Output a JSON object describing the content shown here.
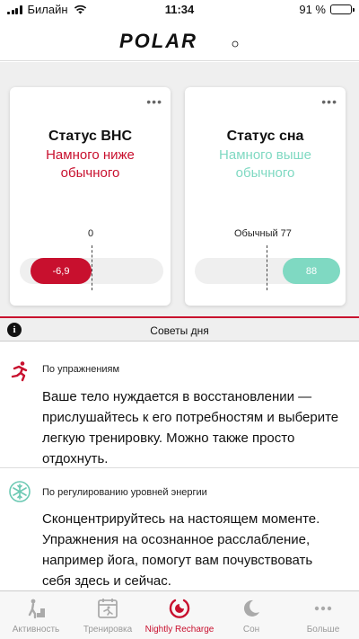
{
  "status_bar": {
    "carrier": "Билайн",
    "time": "11:34",
    "battery_text": "91 %",
    "battery_level": 0.91
  },
  "header": {
    "logo_text": "POLAR"
  },
  "cards": [
    {
      "title": "Статус ВНС",
      "subtitle": "Намного ниже обычного",
      "subtitle_color": "#c8102e",
      "marker_label": "0",
      "value": "-6,9",
      "value_color": "#c8102e"
    },
    {
      "title": "Статус сна",
      "subtitle": "Намного выше обычного",
      "subtitle_color": "#7fd9c2",
      "marker_label": "Обычный 77",
      "value": "88",
      "value_color": "#7fd9c2"
    }
  ],
  "tips_header": {
    "label": "Советы дня"
  },
  "tips": [
    {
      "icon": "running-icon",
      "category": "По упражнениям",
      "text": "Ваше тело нуждается в восстановлении — прислушайтесь к его потребностям и выберите легкую тренировку. Можно также просто отдохнуть."
    },
    {
      "icon": "snowflake-icon",
      "category": "По регулированию уровней энергии",
      "text": "Сконцентрируйтесь на настоящем моменте. Упражнения на осознанное расслабление, например йога, помогут вам почувствовать себя здесь и сейчас."
    }
  ],
  "nav": {
    "items": [
      {
        "label": "Активность",
        "icon": "activity-icon",
        "active": false
      },
      {
        "label": "Тренировка",
        "icon": "training-icon",
        "active": false
      },
      {
        "label": "Nightly Recharge",
        "icon": "recharge-icon",
        "active": true
      },
      {
        "label": "Сон",
        "icon": "moon-icon",
        "active": false
      },
      {
        "label": "Больше",
        "icon": "more-icon",
        "active": false
      }
    ]
  },
  "colors": {
    "accent": "#c8102e",
    "mint": "#7fd9c2"
  }
}
